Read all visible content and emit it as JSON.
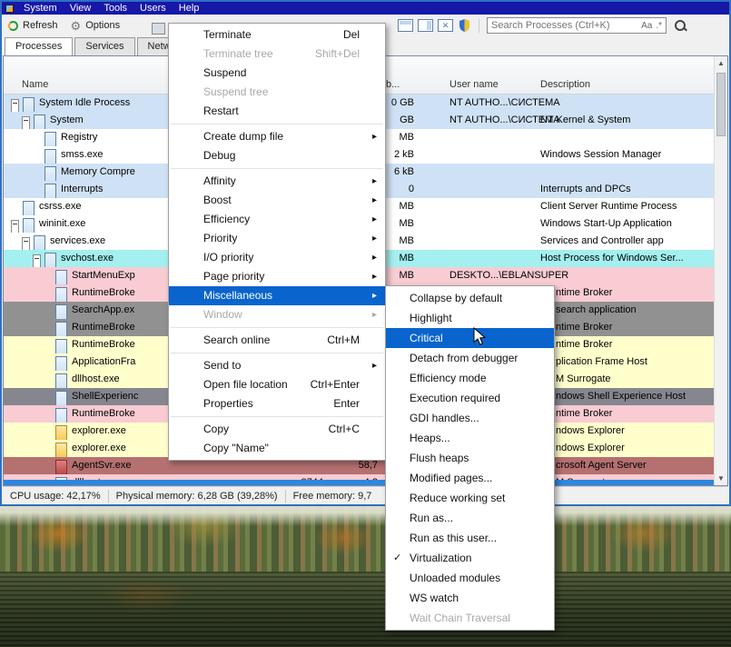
{
  "menubar": {
    "items": [
      "System",
      "View",
      "Tools",
      "Users",
      "Help"
    ]
  },
  "toolbar": {
    "refresh_label": "Refresh",
    "options_label": "Options",
    "search_placeholder": "Search Processes (Ctrl+K)",
    "case_toggle": "Aa",
    "regex_toggle": ".*"
  },
  "tabs": [
    "Processes",
    "Services",
    "Network"
  ],
  "columns": {
    "name": "Name",
    "private_fragment": "b...",
    "user": "User name",
    "description": "Description"
  },
  "rows": [
    {
      "name": "System Idle Process",
      "depth": 0,
      "expander": true,
      "icon": "app",
      "color": "row_system",
      "pvt": "0 GB",
      "user": "NT AUTHO...\\СИСТЕМА",
      "desc": ""
    },
    {
      "name": "System",
      "depth": 1,
      "expander": true,
      "icon": "app",
      "color": "row_system",
      "pvt": "GB",
      "user": "NT AUTHO...\\СИСТЕМА",
      "desc": "NT Kernel & System"
    },
    {
      "name": "Registry",
      "depth": 2,
      "expander": false,
      "icon": "app",
      "color": "row_default",
      "pvt": "MB",
      "user": "",
      "desc": ""
    },
    {
      "name": "smss.exe",
      "depth": 2,
      "expander": false,
      "icon": "app",
      "color": "row_default",
      "pvt": "2 kB",
      "user": "",
      "desc": "Windows Session Manager"
    },
    {
      "name": "Memory Compre",
      "depth": 2,
      "expander": false,
      "icon": "app",
      "color": "row_system",
      "pvt": "6 kB",
      "user": "",
      "desc": ""
    },
    {
      "name": "Interrupts",
      "depth": 2,
      "expander": false,
      "icon": "app",
      "color": "row_system",
      "pvt": "0",
      "user": "",
      "desc": "Interrupts and DPCs"
    },
    {
      "name": "csrss.exe",
      "depth": 0,
      "expander": false,
      "icon": "app",
      "color": "row_default",
      "pvt": "MB",
      "user": "",
      "desc": "Client Server Runtime Process"
    },
    {
      "name": "wininit.exe",
      "depth": 0,
      "expander": true,
      "icon": "app",
      "color": "row_default",
      "pvt": "MB",
      "user": "",
      "desc": "Windows Start-Up Application"
    },
    {
      "name": "services.exe",
      "depth": 1,
      "expander": true,
      "icon": "app",
      "color": "row_default",
      "pvt": "MB",
      "user": "",
      "desc": "Services and Controller app"
    },
    {
      "name": "svchost.exe",
      "depth": 2,
      "expander": true,
      "icon": "app",
      "color": "row_selected",
      "pvt": "MB",
      "user": "",
      "desc": "Host Process for Windows Ser..."
    },
    {
      "name": "StartMenuExp",
      "depth": 3,
      "expander": false,
      "icon": "app",
      "color": "row_service",
      "pvt": "MB",
      "user": "DESKTO...\\EBLANSUPER",
      "desc": ""
    },
    {
      "name": "RuntimeBroke",
      "depth": 3,
      "expander": false,
      "icon": "app",
      "color": "row_service",
      "pvt": "",
      "user": "",
      "desc": "ntime Broker"
    },
    {
      "name": "SearchApp.ex",
      "depth": 3,
      "expander": false,
      "icon": "app",
      "color": "row_gray",
      "pvt": "",
      "user": "",
      "desc": "search application"
    },
    {
      "name": "RuntimeBroke",
      "depth": 3,
      "expander": false,
      "icon": "app",
      "color": "row_gray",
      "pvt": "",
      "user": "",
      "desc": "ntime Broker"
    },
    {
      "name": "RuntimeBroke",
      "depth": 3,
      "expander": false,
      "icon": "app",
      "color": "row_own",
      "pvt": "",
      "user": "",
      "desc": "ntime Broker"
    },
    {
      "name": "ApplicationFra",
      "depth": 3,
      "expander": false,
      "icon": "app",
      "color": "row_own",
      "pvt": "",
      "user": "",
      "desc": "plication Frame Host"
    },
    {
      "name": "dllhost.exe",
      "depth": 3,
      "expander": false,
      "icon": "app",
      "color": "row_own",
      "pvt": "",
      "user": "",
      "desc": "M Surrogate"
    },
    {
      "name": "ShellExperienc",
      "depth": 3,
      "expander": false,
      "icon": "app",
      "color": "row_darkgray",
      "pvt": "",
      "user": "",
      "desc": "ndows Shell Experience Host"
    },
    {
      "name": "RuntimeBroke",
      "depth": 3,
      "expander": false,
      "icon": "app",
      "color": "row_service",
      "pvt": "",
      "user": "",
      "desc": "ntime Broker"
    },
    {
      "name": "explorer.exe",
      "depth": 3,
      "expander": false,
      "icon": "folder",
      "color": "row_own",
      "pvt": "",
      "user": "",
      "desc": "ndows Explorer"
    },
    {
      "name": "explorer.exe",
      "depth": 3,
      "expander": false,
      "icon": "folder",
      "color": "row_own",
      "pvt": "",
      "user": "",
      "desc": "ndows Explorer"
    },
    {
      "name": "AgentSvr.exe",
      "depth": 3,
      "expander": false,
      "icon": "agent",
      "color": "row_agent",
      "pvt": "",
      "rate": "58,7",
      "user": "",
      "desc": "crosoft Agent Server"
    },
    {
      "name": "dllhost.exe",
      "depth": 3,
      "expander": false,
      "icon": "app",
      "color": "row_service",
      "pvt": "",
      "pid": "8744",
      "rate": "4,2",
      "user": "",
      "desc": "M Surrogate"
    }
  ],
  "context_menu": {
    "items": [
      {
        "label": "Terminate",
        "shortcut": "Del"
      },
      {
        "label": "Terminate tree",
        "shortcut": "Shift+Del",
        "disabled": true
      },
      {
        "label": "Suspend"
      },
      {
        "label": "Suspend tree",
        "disabled": true
      },
      {
        "label": "Restart",
        "separator_after": true
      },
      {
        "label": "Create dump file",
        "submenu": true
      },
      {
        "label": "Debug",
        "separator_after": true
      },
      {
        "label": "Affinity",
        "submenu": true
      },
      {
        "label": "Boost",
        "submenu": true
      },
      {
        "label": "Efficiency",
        "submenu": true
      },
      {
        "label": "Priority",
        "submenu": true
      },
      {
        "label": "I/O priority",
        "submenu": true
      },
      {
        "label": "Page priority",
        "submenu": true
      },
      {
        "label": "Miscellaneous",
        "submenu": true,
        "selected": true
      },
      {
        "label": "Window",
        "submenu": true,
        "disabled": true,
        "separator_after": true
      },
      {
        "label": "Search online",
        "shortcut": "Ctrl+M",
        "separator_after": true
      },
      {
        "label": "Send to",
        "submenu": true
      },
      {
        "label": "Open file location",
        "shortcut": "Ctrl+Enter"
      },
      {
        "label": "Properties",
        "shortcut": "Enter",
        "separator_after": true
      },
      {
        "label": "Copy",
        "shortcut": "Ctrl+C"
      },
      {
        "label": "Copy \"Name\""
      }
    ]
  },
  "submenu": {
    "items": [
      {
        "label": "Collapse by default"
      },
      {
        "label": "Highlight"
      },
      {
        "label": "Critical",
        "selected": true
      },
      {
        "label": "Detach from debugger"
      },
      {
        "label": "Efficiency mode"
      },
      {
        "label": "Execution required"
      },
      {
        "label": "GDI handles..."
      },
      {
        "label": "Heaps..."
      },
      {
        "label": "Flush heaps"
      },
      {
        "label": "Modified pages..."
      },
      {
        "label": "Reduce working set"
      },
      {
        "label": "Run as..."
      },
      {
        "label": "Run as this user..."
      },
      {
        "label": "Virtualization",
        "checked": true
      },
      {
        "label": "Unloaded modules"
      },
      {
        "label": "WS watch"
      },
      {
        "label": "Wait Chain Traversal",
        "disabled": true
      }
    ]
  },
  "statusbar": {
    "cpu": "CPU usage: 42,17%",
    "physical": "Physical memory: 6,28 GB (39,28%)",
    "free": "Free memory: 9,7"
  },
  "icons": {
    "submenu_arrow": "▸",
    "checkmark": "✓",
    "scroll_up": "▲",
    "scroll_down": "▼",
    "expander": "minus-box",
    "refresh": "circular-arrow",
    "options": "⚙",
    "uac": "shield",
    "search": "magnifier"
  },
  "colors": {
    "row_system": "#cfe2f5",
    "row_default": "#ffffff",
    "row_selected": "#a4efef",
    "row_service": "#f8ccd2",
    "row_own": "#ffffcc",
    "row_gray": "#919191",
    "row_darkgray": "#86868f",
    "row_agent": "#b57070",
    "menu_highlight": "#0a64cd",
    "menubar_bg": "#1717a8",
    "window_border": "#2e6fc4"
  }
}
